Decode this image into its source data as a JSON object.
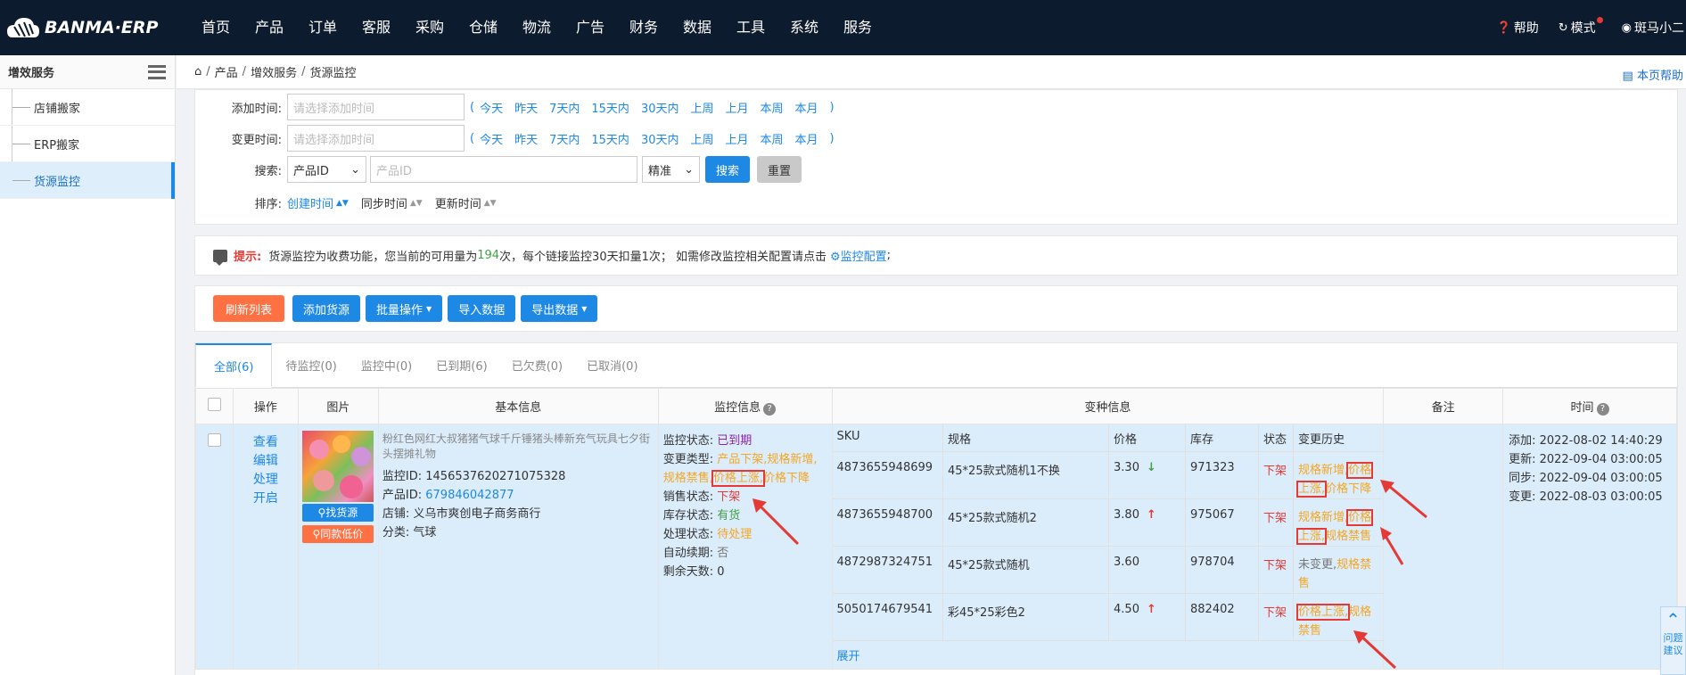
{
  "topbar": {
    "brand": "BANMA·ERP",
    "nav": [
      "首页",
      "产品",
      "订单",
      "客服",
      "采购",
      "仓储",
      "物流",
      "广告",
      "财务",
      "数据",
      "工具",
      "系统",
      "服务"
    ],
    "help": "帮助",
    "mode": "模式",
    "user": "斑马小二"
  },
  "sidebar": {
    "title": "增效服务",
    "items": [
      "店铺搬家",
      "ERP搬家",
      "货源监控"
    ]
  },
  "breadcrumb": {
    "items": [
      "产品",
      "增效服务",
      "货源监控"
    ],
    "page_help": "本页帮助"
  },
  "filter": {
    "add_time_label": "添加时间:",
    "add_time_placeholder": "请选择添加时间",
    "change_time_label": "变更时间:",
    "change_time_placeholder": "请选择添加时间",
    "quick_ranges": [
      "今天",
      "昨天",
      "7天内",
      "15天内",
      "30天内",
      "上周",
      "上月",
      "本周",
      "本月"
    ],
    "search_label": "搜索:",
    "search_field": "产品ID",
    "search_placeholder": "产品ID",
    "match_mode": "精准",
    "search_btn": "搜索",
    "reset_btn": "重置",
    "sort_label": "排序:",
    "sort_options": [
      "创建时间",
      "同步时间",
      "更新时间"
    ]
  },
  "tip": {
    "label": "提示:",
    "text1": "货源监控为收费功能，您当前的可用量为",
    "count": "194",
    "text2": "次，每个链接监控30天扣量1次；  如需修改监控相关配置请点击",
    "link": "监控配置",
    "end": ";"
  },
  "toolbar": {
    "refresh": "刷新列表",
    "add": "添加货源",
    "batch": "批量操作",
    "import": "导入数据",
    "export": "导出数据"
  },
  "tabs": [
    "全部(6)",
    "待监控(0)",
    "监控中(0)",
    "已到期(6)",
    "已欠费(0)",
    "已取消(0)"
  ],
  "table": {
    "headers": {
      "op": "操作",
      "pic": "图片",
      "basic": "基本信息",
      "monitor": "监控信息",
      "variant": "变种信息",
      "remark": "备注",
      "time": "时间"
    },
    "variant_headers": [
      "SKU",
      "规格",
      "价格",
      "库存",
      "状态",
      "变更历史"
    ],
    "row": {
      "ops": [
        "查看",
        "编辑",
        "处理",
        "开启"
      ],
      "find_source": "找货源",
      "same_low": "同款低价",
      "name": "粉红色网红大叔猪猪气球千斤锤猪头棒新充气玩具七夕街头摆摊礼物",
      "monitor_id_label": "监控ID:",
      "monitor_id": "1456537620271075328",
      "product_id_label": "产品ID:",
      "product_id": "679846042877",
      "shop_label": "店铺:",
      "shop": "义乌市爽创电子商务商行",
      "cat_label": "分类:",
      "cat": "气球",
      "monitor": {
        "status_label": "监控状态:",
        "status": "已到期",
        "change_type_label": "变更类型:",
        "change_types": [
          "产品下架,",
          "规格新增,",
          "规格禁售,",
          "价格上涨,",
          "价格下降"
        ],
        "sale_label": "销售状态:",
        "sale": "下架",
        "stock_label": "库存状态:",
        "stock": "有货",
        "proc_label": "处理状态:",
        "proc": "待处理",
        "renew_label": "自动续期:",
        "renew": "否",
        "days_label": "剩余天数:",
        "days": "0"
      },
      "variants": [
        {
          "sku": "4873655948699",
          "spec": "45*25款式随机1不换",
          "price": "3.30",
          "trend": "down",
          "stock": "971323",
          "status": "下架",
          "hist": [
            "规格新增,",
            "价格上涨,",
            "价格下降"
          ]
        },
        {
          "sku": "4873655948700",
          "spec": "45*25款式随机2",
          "price": "3.80",
          "trend": "up",
          "stock": "975067",
          "status": "下架",
          "hist": [
            "规格新增,",
            "价格上涨,",
            "规格禁售"
          ]
        },
        {
          "sku": "4872987324751",
          "spec": "45*25款式随机",
          "price": "3.60",
          "trend": "",
          "stock": "978704",
          "status": "下架",
          "hist": [
            "未变更,",
            "规格禁售"
          ]
        },
        {
          "sku": "5050174679541",
          "spec": "彩45*25彩色2",
          "price": "4.50",
          "trend": "up",
          "stock": "882402",
          "status": "下架",
          "hist": [
            "价格上涨,",
            "规格禁售"
          ]
        }
      ],
      "expand": "展开",
      "time": [
        "添加: 2022-08-02 14:40:29",
        "更新: 2022-09-04 03:00:05",
        "同步: 2022-09-04 03:00:05",
        "变更: 2022-08-03 03:00:05"
      ]
    }
  },
  "side_help": "问题建议"
}
